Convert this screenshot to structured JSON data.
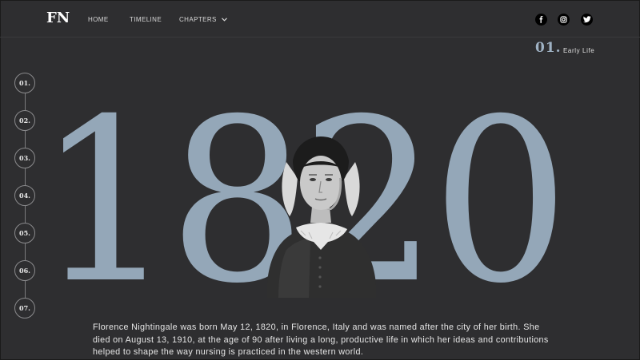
{
  "header": {
    "logo": "FN",
    "nav": [
      {
        "label": "HOME"
      },
      {
        "label": "TIMELINE"
      },
      {
        "label": "CHAPTERS"
      }
    ],
    "social": [
      {
        "icon": "facebook-icon"
      },
      {
        "icon": "instagram-icon"
      },
      {
        "icon": "twitter-icon"
      }
    ]
  },
  "chapter": {
    "number": "01.",
    "name": "Early Life"
  },
  "timeline": {
    "nodes": [
      "01.",
      "02.",
      "03.",
      "04.",
      "05.",
      "06.",
      "07."
    ]
  },
  "hero": {
    "year": "1820",
    "year_color": "#94a7b8"
  },
  "body": {
    "text": "Florence Nightingale was born May 12, 1820, in Florence, Italy and was named after the city of her birth. She died on August 13, 1910, at the age of 90 after living a long, productive life in which her ideas and contributions helped to shape the way nursing is practiced in the western world."
  },
  "colors": {
    "background": "#2e2e30",
    "accent": "#9fb2c4"
  }
}
